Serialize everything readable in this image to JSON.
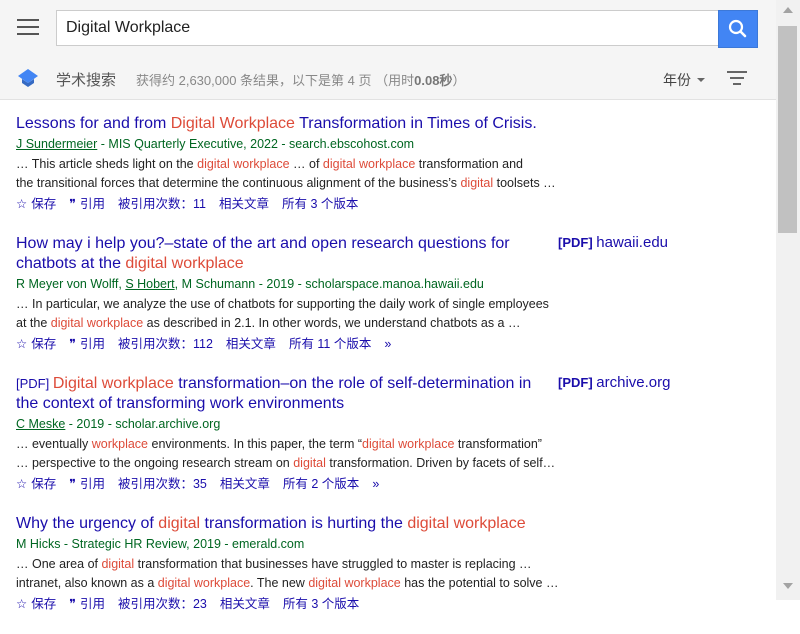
{
  "search": {
    "query": "Digital Workplace"
  },
  "subbar": {
    "brand": "学术搜索",
    "stats_prefix": "获得约 2,630,000 条结果，以下是第 4 页 （用时",
    "stats_time": "0.08秒",
    "stats_suffix": "）",
    "year_label": "年份"
  },
  "results": [
    {
      "title_parts": [
        {
          "t": "Lessons for and from ",
          "hl": false
        },
        {
          "t": "Digital Workplace",
          "hl": true
        },
        {
          "t": " Transformation in Times of Crisis.",
          "hl": false
        }
      ],
      "authors": "J Sundermeier",
      "meta_rest": " - MIS Quarterly Executive, 2022 - search.ebscohost.com",
      "snippet_lines": [
        [
          {
            "t": "… This article sheds light on the ",
            "hl": false
          },
          {
            "t": "digital workplace",
            "hl": true
          },
          {
            "t": " … of ",
            "hl": false
          },
          {
            "t": "digital workplace",
            "hl": true
          },
          {
            "t": " transformation and",
            "hl": false
          }
        ],
        [
          {
            "t": "the transitional forces that determine the continuous alignment of the business’s ",
            "hl": false
          },
          {
            "t": "digital",
            "hl": true
          },
          {
            "t": " toolsets …",
            "hl": false
          }
        ]
      ],
      "actions": {
        "save": "保存",
        "cite": "引用",
        "cited_by": "被引用次数：11",
        "related": "相关文章",
        "versions": "所有 3 个版本"
      }
    },
    {
      "title_parts": [
        {
          "t": "How may i help you?–state of the art and open research questions for chatbots at the ",
          "hl": false
        },
        {
          "t": "digital workplace",
          "hl": true
        }
      ],
      "side_tag": "[PDF]",
      "side_source": "hawaii.edu",
      "authors_list": [
        {
          "name": "R Meyer von Wolff",
          "u": false
        },
        {
          "name": "S Hobert",
          "u": true
        },
        {
          "name": "M Schumann",
          "u": false
        }
      ],
      "meta_rest": " - 2019 - scholarspace.manoa.hawaii.edu",
      "snippet_lines": [
        [
          {
            "t": "… In particular, we analyze the use of chatbots for supporting the daily work of single employees",
            "hl": false
          }
        ],
        [
          {
            "t": "at the ",
            "hl": false
          },
          {
            "t": "digital workplace",
            "hl": true
          },
          {
            "t": " as described in 2.1. In other words, we understand chatbots as a …",
            "hl": false
          }
        ]
      ],
      "actions": {
        "save": "保存",
        "cite": "引用",
        "cited_by": "被引用次数：112",
        "related": "相关文章",
        "versions": "所有 11 个版本",
        "more": "»"
      }
    },
    {
      "title_tag": "[PDF]",
      "title_parts": [
        {
          "t": "Digital workplace",
          "hl": true
        },
        {
          "t": " transformation–on the role of self-determination in the context of transforming work environments",
          "hl": false
        }
      ],
      "side_tag": "[PDF]",
      "side_source": "archive.org",
      "authors": "C Meske",
      "meta_rest": " - 2019 - scholar.archive.org",
      "snippet_lines": [
        [
          {
            "t": "… eventually ",
            "hl": false
          },
          {
            "t": "workplace",
            "hl": true
          },
          {
            "t": " environments. In this paper, the term “",
            "hl": false
          },
          {
            "t": "digital workplace",
            "hl": true
          },
          {
            "t": " transformation”",
            "hl": false
          }
        ],
        [
          {
            "t": "… perspective to the ongoing research stream on ",
            "hl": false
          },
          {
            "t": "digital",
            "hl": true
          },
          {
            "t": " transformation. Driven by facets of self…",
            "hl": false
          }
        ]
      ],
      "actions": {
        "save": "保存",
        "cite": "引用",
        "cited_by": "被引用次数：35",
        "related": "相关文章",
        "versions": "所有 2 个版本",
        "more": "»"
      }
    },
    {
      "title_parts": [
        {
          "t": "Why the urgency of ",
          "hl": false
        },
        {
          "t": "digital",
          "hl": true
        },
        {
          "t": " transformation is hurting the ",
          "hl": false
        },
        {
          "t": "digital workplace",
          "hl": true
        }
      ],
      "meta_full": "M Hicks - Strategic HR Review, 2019 - emerald.com",
      "snippet_lines": [
        [
          {
            "t": "… One area of ",
            "hl": false
          },
          {
            "t": "digital",
            "hl": true
          },
          {
            "t": " transformation that businesses have struggled to master is replacing …",
            "hl": false
          }
        ],
        [
          {
            "t": "intranet, also known as a ",
            "hl": false
          },
          {
            "t": "digital workplace",
            "hl": true
          },
          {
            "t": ". The new ",
            "hl": false
          },
          {
            "t": "digital workplace",
            "hl": true
          },
          {
            "t": " has the potential to solve …",
            "hl": false
          }
        ]
      ],
      "actions": {
        "save": "保存",
        "cite": "引用",
        "cited_by": "被引用次数：23",
        "related": "相关文章",
        "versions": "所有 3 个版本"
      }
    }
  ]
}
